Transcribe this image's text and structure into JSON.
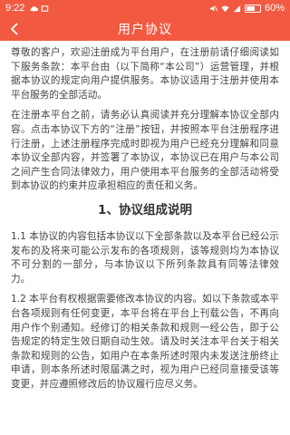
{
  "status_bar": {
    "time": "9:22",
    "battery_percent": "60%",
    "icons": [
      "cloud-icon",
      "box-icon",
      "mute-icon",
      "wifi-icon",
      "signal-icon",
      "battery-icon"
    ]
  },
  "header": {
    "title": "用户协议",
    "back_icon": "chevron-left-icon"
  },
  "colors": {
    "accent": "#f15a41",
    "text": "#444444",
    "background": "#ffffff"
  },
  "agreement": {
    "intro_paragraphs": [
      "尊敬的客户，欢迎注册成为平台用户，在注册前请仔细阅读如下服务条款：本平台由（以下简称“本公司”）运营管理，并根据本协议的规定向用户提供服务。本协议适用于注册并使用本平台服务的全部活动。",
      "在注册本平台之前，请务必认真阅读并充分理解本协议全部内容。点击本协议下方的“注册”按钮，并按照本平台注册程序进行注册，上述注册程序完成时即视为用户已经充分理解和同意本协议全部内容，并签署了本协议，本协议已在用户与本公司之间产生合同法律效力，用户使用本平台服务的全部活动将受到本协议的约束并应承担相应的责任和义务。"
    ],
    "section_title": "1、协议组成说明",
    "section_paragraphs": [
      "1.1 本协议的内容包括本协议以下全部条款以及本平台已经公示发布的及将来可能公示发布的各项规则，该等规则均为本协议不可分割的一部分，与本协议以下所列条款具有同等法律效力。",
      "1.2 本平台有权根据需要修改本协议的内容。如以下条款或本平台各项规则有任何变更，本平台将在平台上刊载公告，不再向用户作个别通知。经修订的相关条款和规则一经公告，即于公告规定的特定生效日期自动生效。请及时关注本平台关于相关条款和规则的公告，如用户在本条所述时限内未发送注册终止申请，则本条所述时限届满之时，视为用户已经同意接受该等变更，并应遵照修改后的协议履行应尽义务。"
    ]
  }
}
